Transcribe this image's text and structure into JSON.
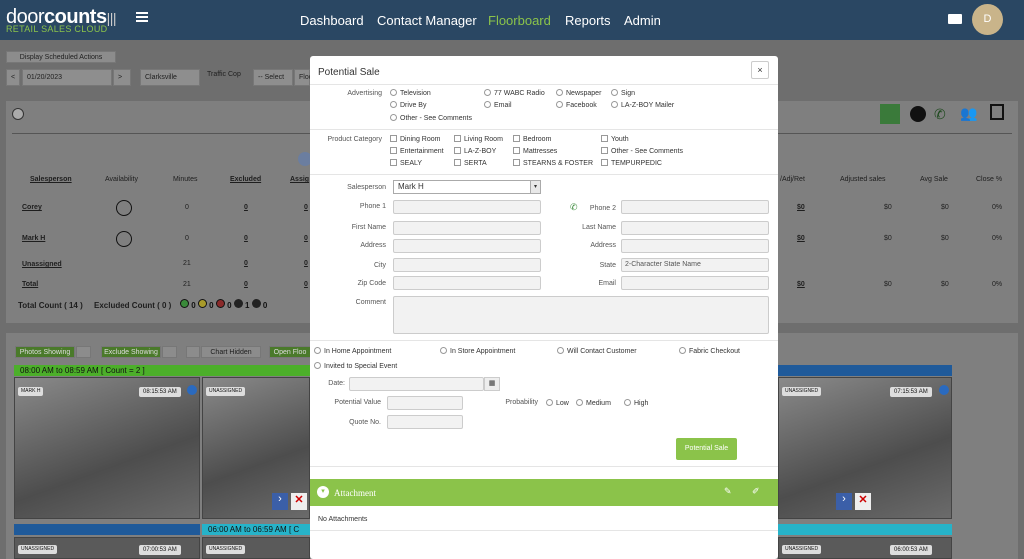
{
  "nav": {
    "logo_main_light": "door",
    "logo_main_bold": "counts",
    "logo_sub": "RETAIL SALES CLOUD",
    "links": [
      "Dashboard",
      "Contact Manager",
      "Floorboard",
      "Reports",
      "Admin"
    ],
    "active": "Floorboard",
    "avatar_initial": "D"
  },
  "controls": {
    "scheduled_btn": "Display Scheduled Actions",
    "prev": "<",
    "date": "01/20/2023",
    "next": ">",
    "location": "Clarksville",
    "traffic_label": "Traffic Cop",
    "traffic_select": "-- Select",
    "floor_select": "Floo"
  },
  "table": {
    "headers": [
      "Salesperson",
      "Availability",
      "Minutes",
      "Excluded",
      "Assig",
      "/Adj/Ret",
      "Adjusted sales",
      "Avg Sale",
      "Close %"
    ],
    "rows": [
      {
        "name": "Corey",
        "minutes": "0",
        "excluded": "0",
        "assigned": "0",
        "adj": "$0",
        "sales": "$0",
        "avg": "$0",
        "close": "0%"
      },
      {
        "name": "Mark H",
        "minutes": "0",
        "excluded": "0",
        "assigned": "0",
        "adj": "$0",
        "sales": "$0",
        "avg": "$0",
        "close": "0%"
      },
      {
        "name": "Unassigned",
        "minutes": "21",
        "excluded": "0",
        "assigned": "0",
        "adj": "",
        "sales": "",
        "avg": "",
        "close": ""
      },
      {
        "name": "Total",
        "minutes": "21",
        "excluded": "0",
        "assigned": "0",
        "adj": "$0",
        "sales": "$0",
        "avg": "$0",
        "close": "0%"
      }
    ],
    "total_count": "Total Count ( 14 )",
    "excluded_count": "Excluded Count ( 0 )",
    "badge_counts": [
      "0",
      "0",
      "0",
      "1",
      "0"
    ]
  },
  "toggles": {
    "photos": "Photos Showing",
    "exclude": "Exclude Showing",
    "chart": "Chart Hidden",
    "floor": "Open Floo"
  },
  "cameras": {
    "group1": "08:00 AM to 08:59 AM [ Count = 2 ]",
    "group2": "06:00 AM to 06:59 AM [ C",
    "cam1_name": "MARK H",
    "cam1_time": "08:15:53 AM",
    "cam2_name": "UNASSIGNED",
    "cam3_name": "UNASSIGNED",
    "cam3_time": "07:15:53 AM",
    "bottom": [
      {
        "name": "UNASSIGNED",
        "time": "07:00:53 AM"
      },
      {
        "name": "UNASSIGNED",
        "time": ""
      },
      {
        "name": "",
        "time": "06:45:53 AM"
      },
      {
        "name": "UNASSIGNED",
        "time": "06:30:53 AM"
      },
      {
        "name": "UNASSIGNED",
        "time": "06:15:54 AM"
      },
      {
        "name": "UNASSIGNED",
        "time": "06:00:53 AM"
      }
    ]
  },
  "modal": {
    "title": "Potential Sale",
    "close": "×",
    "advertising_label": "Advertising",
    "advertising": [
      "Television",
      "77 WABC Radio",
      "Newspaper",
      "Sign",
      "Drive By",
      "Email",
      "Facebook",
      "LA-Z-BOY Mailer",
      "Other - See Comments"
    ],
    "product_label": "Product Category",
    "products": [
      "Dining Room",
      "Living Room",
      "Bedroom",
      "Youth",
      "Entertainment",
      "LA-Z-BOY",
      "Mattresses",
      "Other - See Comments",
      "SEALY",
      "SERTA",
      "STEARNS & FOSTER",
      "TEMPURPEDIC"
    ],
    "salesperson_label": "Salesperson",
    "salesperson_value": "Mark H",
    "phone1": "Phone 1",
    "phone2": "Phone 2",
    "first_name": "First Name",
    "last_name": "Last Name",
    "address": "Address",
    "address2": "Address",
    "city": "City",
    "state": "State",
    "state_placeholder": "2-Character State Name",
    "zip": "Zip Code",
    "email": "Email",
    "comment": "Comment",
    "appointments": [
      "In Home Appointment",
      "In Store Appointment",
      "Will Contact Customer",
      "Fabric Checkout",
      "Invited to Special Event"
    ],
    "date_label": "Date:",
    "potential_value": "Potential Value",
    "probability": "Probability",
    "prob_options": [
      "Low",
      "Medium",
      "High"
    ],
    "quote": "Quote No.",
    "submit": "Potential Sale",
    "attachment": "Attachment",
    "no_attachments": "No Attachments"
  }
}
